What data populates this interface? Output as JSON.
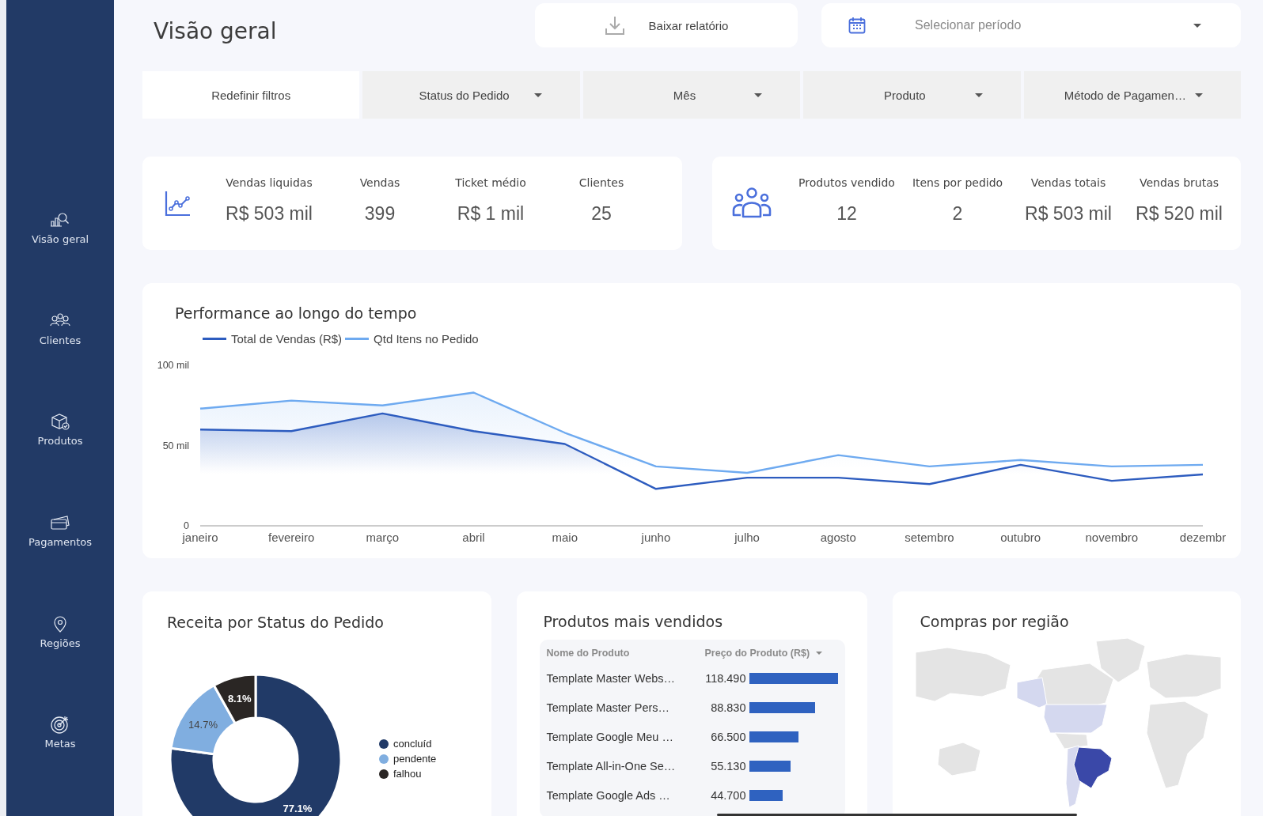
{
  "sidebar": {
    "items": [
      {
        "label": "Visão geral"
      },
      {
        "label": "Clientes"
      },
      {
        "label": "Produtos"
      },
      {
        "label": "Pagamentos"
      },
      {
        "label": "Regiões"
      },
      {
        "label": "Metas"
      }
    ]
  },
  "header": {
    "title": "Visão geral",
    "download_button": "Baixar relatório",
    "period_select": {
      "placeholder": "Selecionar período"
    }
  },
  "filters": {
    "reset_button": "Redefinir filtros",
    "dropdowns": [
      {
        "label": "Status do Pedido"
      },
      {
        "label": "Mês"
      },
      {
        "label": "Produto"
      },
      {
        "label": "Método de Pagamen…"
      }
    ]
  },
  "kpi_cards": [
    {
      "metrics": [
        {
          "label": "Vendas liquidas",
          "value": "R$ 503 mil"
        },
        {
          "label": "Vendas",
          "value": "399"
        },
        {
          "label": "Ticket médio",
          "value": "R$ 1 mil"
        },
        {
          "label": "Clientes",
          "value": "25"
        }
      ]
    },
    {
      "metrics": [
        {
          "label": "Produtos vendido",
          "value": "12"
        },
        {
          "label": "Itens por pedido",
          "value": "2"
        },
        {
          "label": "Vendas totais",
          "value": "R$ 503 mil"
        },
        {
          "label": "Vendas brutas",
          "value": "R$ 520 mil"
        }
      ]
    }
  ],
  "performance_card": {
    "title": "Performance ao longo do tempo",
    "chart_data": {
      "type": "area",
      "categories": [
        "janeiro",
        "fevereiro",
        "março",
        "abril",
        "maio",
        "junho",
        "julho",
        "agosto",
        "setembro",
        "outubro",
        "novembro",
        "dezembr"
      ],
      "series": [
        {
          "name": "Total de Vendas (R$)",
          "color": "#2d5cbf",
          "values": [
            60,
            59,
            70,
            59,
            51,
            23,
            30,
            30,
            26,
            38,
            28,
            32
          ]
        },
        {
          "name": "Qtd Itens no Pedido",
          "color": "#6eaaf0",
          "values": [
            73,
            78,
            75,
            83,
            58,
            37,
            33,
            44,
            37,
            41,
            37,
            38
          ]
        }
      ],
      "ylim": [
        0,
        100
      ],
      "yticks": [
        {
          "value": 0,
          "label": "0"
        },
        {
          "value": 50,
          "label": "50 mil"
        },
        {
          "value": 100,
          "label": "100 mil"
        }
      ]
    }
  },
  "status_card": {
    "title": "Receita por Status do Pedido",
    "chart_data": {
      "type": "donut",
      "categories": [
        "concluíd",
        "pendente",
        "falhou"
      ],
      "values": [
        77.1,
        14.7,
        8.1
      ],
      "colors": [
        "#213a67",
        "#80aee0",
        "#2a2624"
      ],
      "value_labels": [
        "77.1%",
        "14.7%",
        "8.1%"
      ]
    }
  },
  "products_card": {
    "title": "Produtos mais vendidos",
    "columns": [
      "Nome do Produto",
      "Preço do Produto (R$)"
    ],
    "rows": [
      {
        "name": "Template Master Webs…",
        "price": "118.490"
      },
      {
        "name": "Template Master Pers…",
        "price": "88.830"
      },
      {
        "name": "Template Google Meu …",
        "price": "66.500"
      },
      {
        "name": "Template All-in-One Se…",
        "price": "55.130"
      },
      {
        "name": "Template Google Ads …",
        "price": "44.700"
      }
    ]
  },
  "region_card": {
    "title": "Compras por região"
  }
}
